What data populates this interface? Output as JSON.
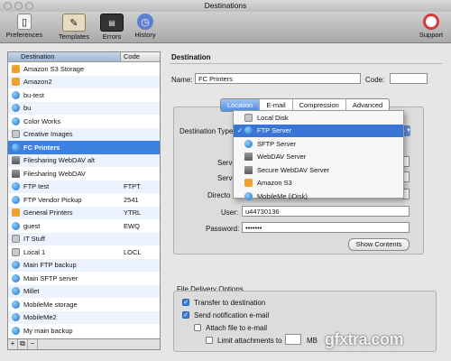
{
  "window": {
    "title": "Destinations"
  },
  "toolbar": {
    "items": [
      {
        "label": "Preferences",
        "icon": "preferences-icon"
      },
      {
        "label": "Templates",
        "icon": "templates-icon"
      },
      {
        "label": "Errors",
        "icon": "errors-icon"
      },
      {
        "label": "History",
        "icon": "history-icon"
      }
    ],
    "support": {
      "label": "Support",
      "icon": "lifebuoy-icon"
    }
  },
  "sidebar": {
    "columns": {
      "name": "Destination",
      "code": "Code"
    },
    "items": [
      {
        "name": "Amazon S3 Storage",
        "code": "",
        "icon": "amazon-icon"
      },
      {
        "name": "Amazon2",
        "code": "",
        "icon": "amazon-icon"
      },
      {
        "name": "bu-test",
        "code": "",
        "icon": "globe-icon"
      },
      {
        "name": "bu",
        "code": "",
        "icon": "globe-icon"
      },
      {
        "name": "Color Works",
        "code": "",
        "icon": "globe-icon"
      },
      {
        "name": "Creative Images",
        "code": "",
        "icon": "disk-icon"
      },
      {
        "name": "FC Printers",
        "code": "",
        "icon": "globe-icon",
        "selected": true
      },
      {
        "name": "Filesharing WebDAV alt",
        "code": "",
        "icon": "server-icon"
      },
      {
        "name": "Filesharing WebDAV",
        "code": "",
        "icon": "server-icon"
      },
      {
        "name": "FTP test",
        "code": "FTPT",
        "icon": "globe-icon"
      },
      {
        "name": "FTP Vendor Pickup",
        "code": "2541",
        "icon": "globe-icon"
      },
      {
        "name": "General Printers",
        "code": "YTRL",
        "icon": "amazon-icon"
      },
      {
        "name": "guest",
        "code": "EWQ",
        "icon": "globe-icon"
      },
      {
        "name": "IT Stuff",
        "code": "",
        "icon": "disk-icon"
      },
      {
        "name": "Local 1",
        "code": "LOCL",
        "icon": "disk-icon"
      },
      {
        "name": "Main FTP backup",
        "code": "",
        "icon": "globe-icon"
      },
      {
        "name": "Main SFTP server",
        "code": "",
        "icon": "globe-icon"
      },
      {
        "name": "Millet",
        "code": "",
        "icon": "globe-icon"
      },
      {
        "name": "MobileMe storage",
        "code": "",
        "icon": "globe-icon"
      },
      {
        "name": "MobileMe2",
        "code": "",
        "icon": "globe-icon"
      },
      {
        "name": "My main backup",
        "code": "",
        "icon": "globe-icon"
      }
    ],
    "footer_buttons": [
      "+",
      "⧉",
      "−"
    ]
  },
  "destination": {
    "heading": "Destination",
    "name_label": "Name:",
    "name_value": "FC Printers",
    "code_label": "Code:",
    "code_value": "",
    "tabs": [
      "Location",
      "E-mail",
      "Compression",
      "Advanced"
    ],
    "active_tab": "Location",
    "type_label": "Destination Type",
    "server_label": "Serve",
    "server2_label": "Serve",
    "directory_label": "Directo",
    "user_label": "User:",
    "user_value": "u44730136",
    "password_label": "Password:",
    "password_value": "•••••••",
    "show_contents": "Show Contents"
  },
  "type_menu": {
    "items": [
      {
        "label": "Local Disk",
        "icon": "disk-icon",
        "checked": false
      },
      {
        "label": "FTP Server",
        "icon": "globe-icon",
        "checked": true
      },
      {
        "label": "SFTP Server",
        "icon": "globe-icon",
        "checked": false
      },
      {
        "label": "WebDAV Server",
        "icon": "server-icon",
        "checked": false
      },
      {
        "label": "Secure WebDAV Server",
        "icon": "server-icon",
        "checked": false
      },
      {
        "label": "Amazon S3",
        "icon": "amazon-icon",
        "checked": false
      },
      {
        "label": "MobileMe (iDisk)",
        "icon": "globe-icon",
        "checked": false
      }
    ],
    "check_mark": "✓"
  },
  "delivery": {
    "heading": "File Delivery Options",
    "transfer": "Transfer to destination",
    "notify": "Send notification e-mail",
    "attach": "Attach file to e-mail",
    "limit": "Limit attachments to",
    "limit_unit": "MB",
    "transfer_checked": true,
    "notify_checked": true,
    "attach_checked": false,
    "limit_checked": false
  },
  "watermark": "gfxtra.com",
  "colors": {
    "selection": "#3d80df",
    "menu_highlight": "#3875d7"
  }
}
